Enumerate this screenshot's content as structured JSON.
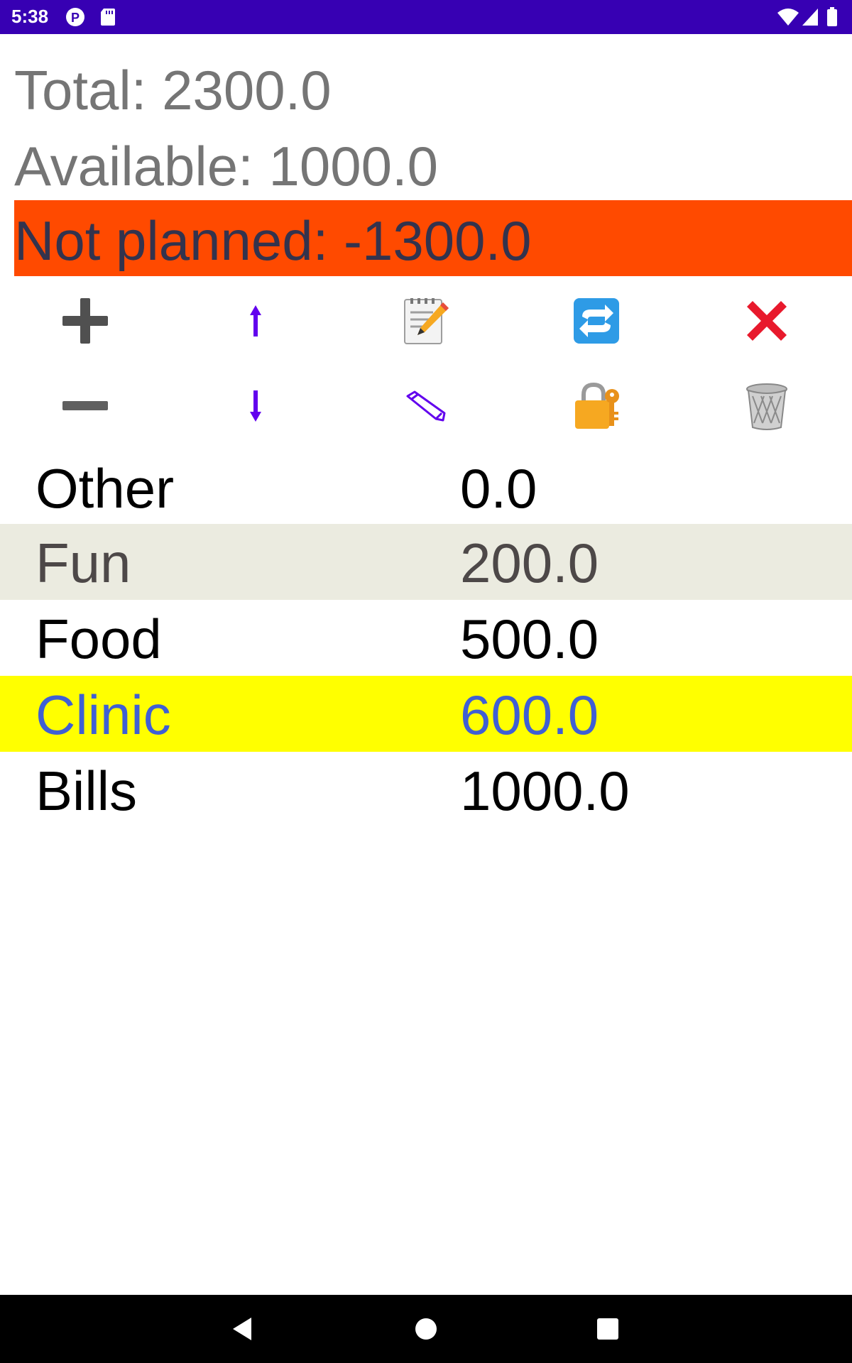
{
  "status_bar": {
    "time": "5:38",
    "icons": [
      "p-badge-icon",
      "sd-card-icon",
      "wifi-icon",
      "signal-icon",
      "battery-icon"
    ]
  },
  "summary": {
    "total": "Total: 2300.0",
    "available": "Available: 1000.0",
    "not_planned": "Not planned: -1300.0",
    "not_planned_color": "#ff4a00"
  },
  "toolbar": {
    "row1": [
      "plus-icon",
      "arrow-up-icon",
      "memo-icon",
      "refresh-icon",
      "cross-mark-icon"
    ],
    "row2": [
      "minus-icon",
      "arrow-down-icon",
      "pencil-icon",
      "lock-with-key-icon",
      "trash-icon"
    ]
  },
  "categories": [
    {
      "name": "Other",
      "amount": "0.0"
    },
    {
      "name": "Fun",
      "amount": "200.0"
    },
    {
      "name": "Food",
      "amount": "500.0"
    },
    {
      "name": "Clinic",
      "amount": "600.0"
    },
    {
      "name": "Bills",
      "amount": "1000.0"
    }
  ],
  "highlight_colors": {
    "fun_row": "#ebebe0",
    "clinic_row": "#ffff00",
    "clinic_text": "#3f5fd4"
  },
  "nav_bar": {
    "buttons": [
      "back-icon",
      "home-icon",
      "recents-icon"
    ]
  }
}
